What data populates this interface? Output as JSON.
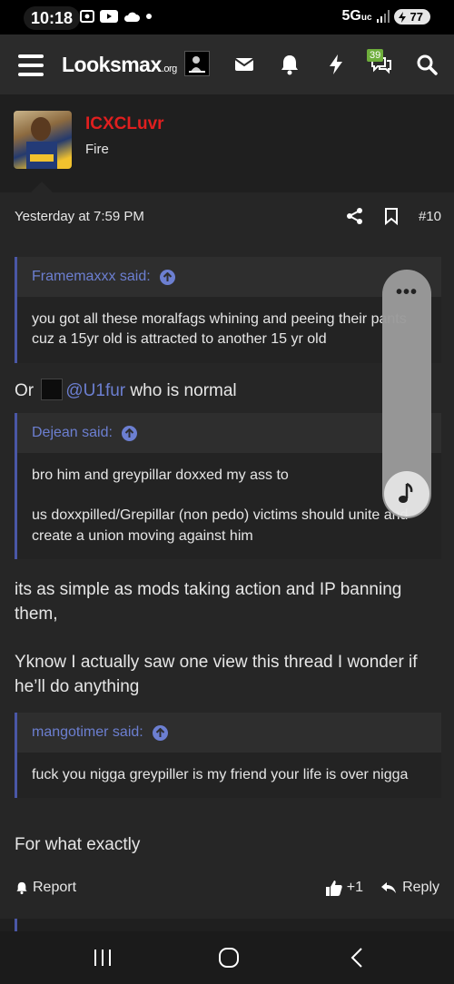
{
  "status_bar": {
    "time": "10:18",
    "network": "5G",
    "network_sub": "uc",
    "battery": "77"
  },
  "header": {
    "logo": "Looksmax",
    "logo_tld": ".org",
    "notification_count": "39",
    "icons": [
      "menu-icon",
      "mail-icon",
      "bell-icon",
      "lightning-icon",
      "chat-icon",
      "search-icon"
    ]
  },
  "post": {
    "username": "ICXCLuvr",
    "user_title": "Fire",
    "date": "Yesterday at 7:59 PM",
    "post_number": "#10",
    "quote1": {
      "author": "Framemaxxx said:",
      "body": "you got all these moralfags whining and peeing their pants cuz a 15yr old is attracted to another 15 yr old"
    },
    "line1_prefix": "Or",
    "line1_mention": "@U1fur",
    "line1_suffix": "who is normal",
    "quote2": {
      "author": "Dejean said:",
      "body1": "bro him and greypillar doxxed my ass to",
      "body2": "us doxxpilled/Grepillar (non pedo) victims should unite and create a union moving against him"
    },
    "paragraph1": "its as simple as mods taking action and IP banning them,",
    "paragraph2": "Yknow I actually saw one view this thread I wonder if he’ll do anything",
    "quote3": {
      "author": "mangotimer said:",
      "body": "fuck you nigga greypiller is my friend your life is over nigga"
    },
    "closing": "For what exactly",
    "report_label": "Report",
    "reaction_count": "+1",
    "reply_label": "Reply"
  },
  "floater": {
    "more": "•••"
  }
}
